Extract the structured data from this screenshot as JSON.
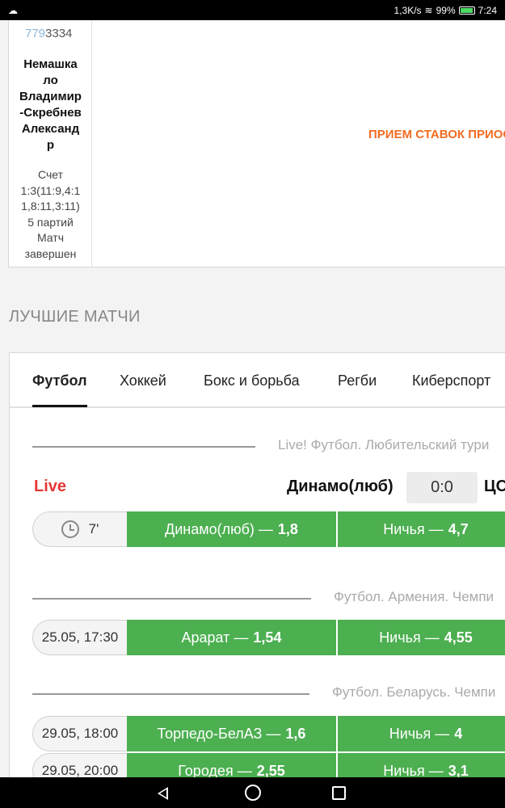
{
  "status_bar": {
    "left_icon": "cloud-icon",
    "speed": "1,3K/s",
    "wifi_icon": "wifi-icon",
    "battery_percent": "99%",
    "battery_level": 0.99,
    "time": "7:24"
  },
  "result": {
    "id_highlight": "779",
    "id_rest": "3334",
    "players": [
      "Немашка",
      "ло",
      "Владимир",
      "-Скребнев",
      "Александ",
      "р"
    ],
    "score_lines": [
      "Счет",
      "1:3(11:9,4:1",
      "1,8:11,3:11)",
      "5 партий",
      "Матч",
      "завершен"
    ],
    "message": "ПРИЕМ СТАВОК ПРИОС"
  },
  "section_title": "ЛУЧШИЕ МАТЧИ",
  "tabs": [
    "Футбол",
    "Хоккей",
    "Бокс и борьба",
    "Регби",
    "Киберспорт"
  ],
  "leagues": [
    "Live! Футбол. Любительский тури",
    "Футбол. Армения. Чемпи",
    "Футбол. Беларусь. Чемпи"
  ],
  "live_match": {
    "live_label": "Live",
    "team1": "Динамо(люб)",
    "score": "0:0",
    "team2": "ЦС",
    "minute": "7'",
    "clock_icon": "clock-icon"
  },
  "bets": [
    {
      "time": "",
      "odd1_label": "Динамо(люб) —",
      "odd1_value": "1,8",
      "draw_label": "Ничья —",
      "draw_value": "4,7"
    },
    {
      "time": "25.05, 17:30",
      "odd1_label": "Арарат —",
      "odd1_value": "1,54",
      "draw_label": "Ничья —",
      "draw_value": "4,55"
    },
    {
      "time": "29.05, 18:00",
      "odd1_label": "Торпедо-БелАЗ —",
      "odd1_value": "1,6",
      "draw_label": "Ничья —",
      "draw_value": "4"
    },
    {
      "time": "29.05, 20:00",
      "odd1_label": "Городея —",
      "odd1_value": "2,55",
      "draw_label": "Ничья —",
      "draw_value": "3,1"
    }
  ],
  "colors": {
    "odd_green": "#4caf50",
    "live_red": "#e53935",
    "message_orange": "#f26c22"
  },
  "nav_icons": [
    "back-icon",
    "home-icon",
    "recent-apps-icon"
  ]
}
